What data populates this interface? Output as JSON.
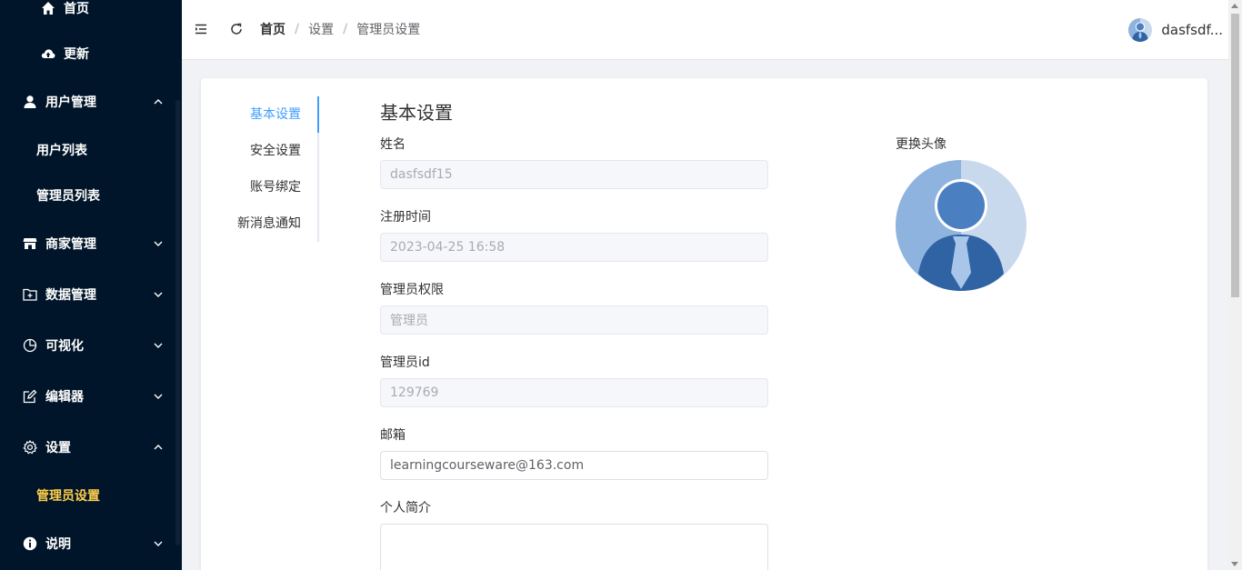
{
  "sidebar": {
    "items": [
      {
        "label": "首页",
        "icon": "home-icon"
      },
      {
        "label": "更新",
        "icon": "cloud-upload-icon"
      },
      {
        "label": "用户管理",
        "icon": "user-icon",
        "expanded": true,
        "children": [
          {
            "label": "用户列表"
          },
          {
            "label": "管理员列表"
          }
        ]
      },
      {
        "label": "商家管理",
        "icon": "shop-icon",
        "expanded": false
      },
      {
        "label": "数据管理",
        "icon": "folder-add-icon",
        "expanded": false
      },
      {
        "label": "可视化",
        "icon": "pie-chart-icon",
        "expanded": false
      },
      {
        "label": "编辑器",
        "icon": "edit-icon",
        "expanded": false
      },
      {
        "label": "设置",
        "icon": "setting-icon",
        "expanded": true,
        "children": [
          {
            "label": "管理员设置",
            "active": true
          }
        ]
      },
      {
        "label": "说明",
        "icon": "info-icon",
        "expanded": false
      }
    ]
  },
  "header": {
    "breadcrumb": [
      "首页",
      "设置",
      "管理员设置"
    ],
    "separator": "/",
    "username": "dasfsdf..."
  },
  "settings_nav": {
    "items": [
      "基本设置",
      "安全设置",
      "账号绑定",
      "新消息通知"
    ],
    "active_index": 0
  },
  "form": {
    "title": "基本设置",
    "name": {
      "label": "姓名",
      "value": "dasfsdf15"
    },
    "register_time": {
      "label": "注册时间",
      "value": "2023-04-25 16:58"
    },
    "permission": {
      "label": "管理员权限",
      "value": "管理员"
    },
    "admin_id": {
      "label": "管理员id",
      "value": "129769"
    },
    "email": {
      "label": "邮箱",
      "value": "learningcourseware@163.com"
    },
    "bio": {
      "label": "个人简介",
      "value": ""
    }
  },
  "avatar": {
    "label": "更换头像"
  },
  "colors": {
    "sidebar_bg": "#001529",
    "active_menu": "#ffd04b",
    "accent": "#409eff"
  }
}
